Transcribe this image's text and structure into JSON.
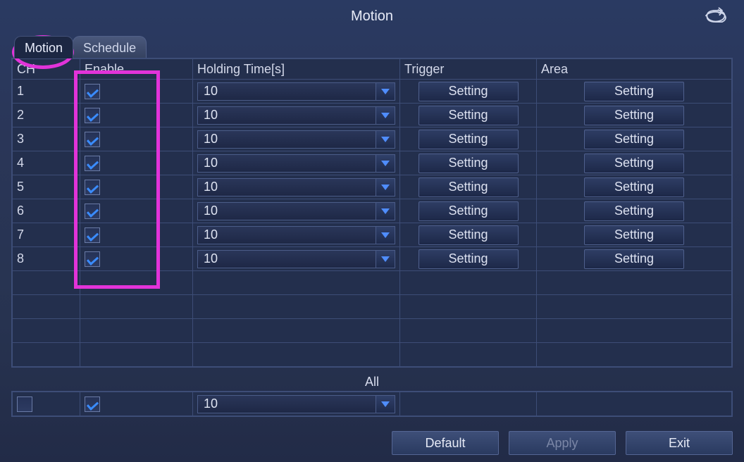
{
  "title": "Motion",
  "tabs": [
    "Motion",
    "Schedule"
  ],
  "active_tab": 0,
  "columns": {
    "ch": "CH",
    "enable": "Enable",
    "holding": "Holding Time[s]",
    "trigger": "Trigger",
    "area": "Area"
  },
  "rows": [
    {
      "ch": "1",
      "enable": true,
      "holding": "10",
      "trigger": "Setting",
      "area": "Setting"
    },
    {
      "ch": "2",
      "enable": true,
      "holding": "10",
      "trigger": "Setting",
      "area": "Setting"
    },
    {
      "ch": "3",
      "enable": true,
      "holding": "10",
      "trigger": "Setting",
      "area": "Setting"
    },
    {
      "ch": "4",
      "enable": true,
      "holding": "10",
      "trigger": "Setting",
      "area": "Setting"
    },
    {
      "ch": "5",
      "enable": true,
      "holding": "10",
      "trigger": "Setting",
      "area": "Setting"
    },
    {
      "ch": "6",
      "enable": true,
      "holding": "10",
      "trigger": "Setting",
      "area": "Setting"
    },
    {
      "ch": "7",
      "enable": true,
      "holding": "10",
      "trigger": "Setting",
      "area": "Setting"
    },
    {
      "ch": "8",
      "enable": true,
      "holding": "10",
      "trigger": "Setting",
      "area": "Setting"
    }
  ],
  "blank_rows": 4,
  "all": {
    "label": "All",
    "select": false,
    "enable": true,
    "holding": "10"
  },
  "footer": {
    "default": "Default",
    "apply": "Apply",
    "exit": "Exit"
  },
  "colors": {
    "annotation": "#e233d9"
  }
}
